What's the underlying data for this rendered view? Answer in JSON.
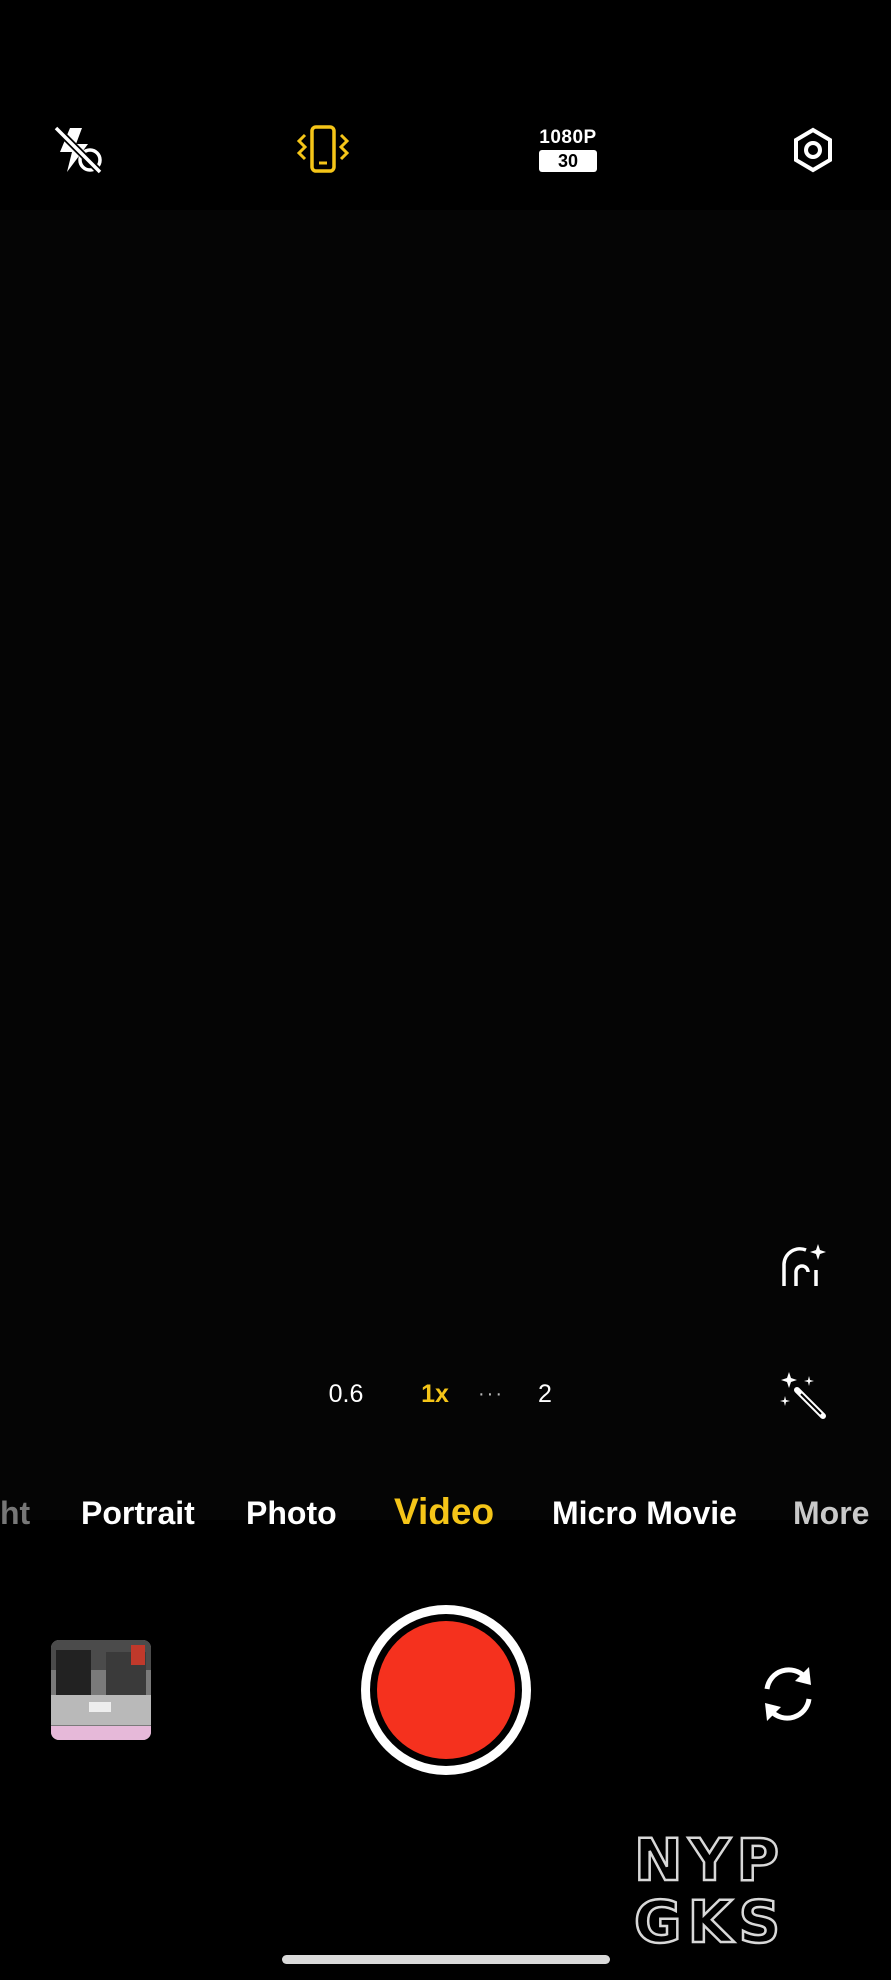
{
  "top_bar": {
    "flash": {
      "icon": "flash-off-icon"
    },
    "stabilization": {
      "icon": "stabilization-icon",
      "color": "#f5c518"
    },
    "resolution": {
      "label": "1080P",
      "fps": "30"
    },
    "settings": {
      "icon": "settings-icon"
    }
  },
  "side_controls": {
    "face_beauty": {
      "icon": "face-beauty-icon"
    },
    "filters": {
      "icon": "magic-wand-icon"
    }
  },
  "zoom": {
    "options": [
      "0.6",
      "1x",
      "2"
    ],
    "selected": "1x",
    "more_indicator": "···",
    "active_color": "#f5c518"
  },
  "modes": {
    "items": [
      "ht",
      "Portrait",
      "Photo",
      "Video",
      "Micro Movie",
      "More"
    ],
    "selected": "Video",
    "active_color": "#f5c518"
  },
  "bottom": {
    "gallery": {
      "icon": "gallery-thumbnail"
    },
    "shutter": {
      "icon": "record-button",
      "color": "#f5311e"
    },
    "switch_camera": {
      "icon": "switch-camera-icon"
    }
  },
  "watermark": {
    "line1": "NYP",
    "line2": "GKS"
  }
}
